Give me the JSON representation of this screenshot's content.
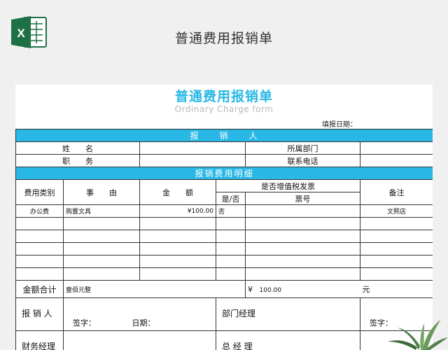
{
  "header": {
    "title": "普通费用报销单"
  },
  "form": {
    "title": "普通费用报销单",
    "subtitle": "Ordinary Charge form",
    "fill_date_label": "填报日期："
  },
  "reporter_section": {
    "heading": "报　　销　　人",
    "name_label": "姓　　名",
    "dept_label": "所属部门",
    "position_label": "职　　务",
    "phone_label": "联系电话"
  },
  "detail_section": {
    "heading": "报销费用明细",
    "col_type": "费用类别",
    "col_reason": "事　　由",
    "col_amount": "金　　额",
    "col_vat": "是否增值税发票",
    "col_yesno": "是/否",
    "col_invoice_no": "票号",
    "col_remark": "备注",
    "rows": [
      {
        "type": "办公费",
        "reason": "购置文具",
        "amount": "¥100.00",
        "vat": "否",
        "invoice": "",
        "remark": "文熙店"
      }
    ]
  },
  "total": {
    "label": "金额合计",
    "in_words": "壹佰元整",
    "currency": "¥",
    "amount": "100.00",
    "unit": "元"
  },
  "signatures": {
    "reporter_label": "报 销 人",
    "dept_manager_label": "部门经理",
    "finance_manager_label": "财务经理",
    "general_manager_label": "总 经 理",
    "sign_label": "签字：",
    "date_label": "日期："
  },
  "colors": {
    "accent": "#29b8e6",
    "excel_green": "#1e7145"
  },
  "icons": {
    "app": "excel-icon",
    "decor": "plant-icon"
  }
}
